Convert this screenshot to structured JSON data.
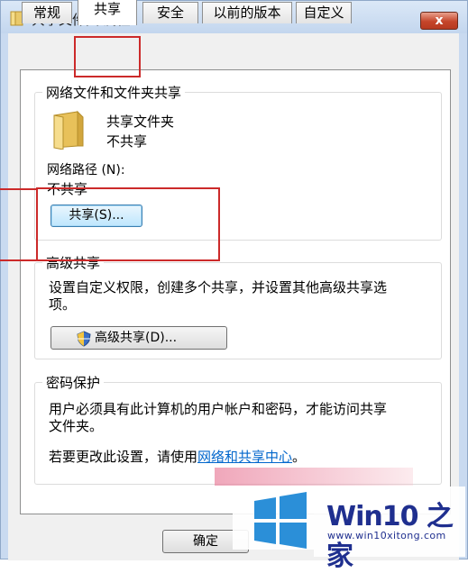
{
  "window": {
    "title": "共享文件夹 属性",
    "close_glyph": "x"
  },
  "tabs": [
    {
      "label": "常规",
      "active": false
    },
    {
      "label": "共享",
      "active": true
    },
    {
      "label": "安全",
      "active": false
    },
    {
      "label": "以前的版本",
      "active": false
    },
    {
      "label": "自定义",
      "active": false
    }
  ],
  "network_sharing": {
    "title": "网络文件和文件夹共享",
    "folder_name": "共享文件夹",
    "folder_status": "不共享",
    "path_label": "网络路径 (N):",
    "path_value": "不共享",
    "share_button": "共享(S)..."
  },
  "advanced_sharing": {
    "title": "高级共享",
    "description_line1": "设置自定义权限，创建多个共享，并设置其他高级共享选",
    "description_line2": "项。",
    "button": "高级共享(D)..."
  },
  "password": {
    "title": "密码保护",
    "description_line1": "用户必须具有此计算机的用户帐户和密码，才能访问共享",
    "description_line2": "文件夹。",
    "change_prefix": "若要更改此设置，请使用",
    "link": "网络和共享中心",
    "change_suffix": "。"
  },
  "footer": {
    "ok_button": "确定"
  },
  "watermark": {
    "title": "Win10 之家",
    "url": "www.win10xitong.com"
  },
  "icons": {
    "folder": "folder-icon",
    "shield": "uac-shield-icon",
    "title": "folder-title-icon",
    "close": "close-icon",
    "logo": "windows-logo-icon"
  },
  "colors": {
    "highlight": "#cc2a2a",
    "link": "#0066cc",
    "watermark": "#1f2f8f"
  }
}
